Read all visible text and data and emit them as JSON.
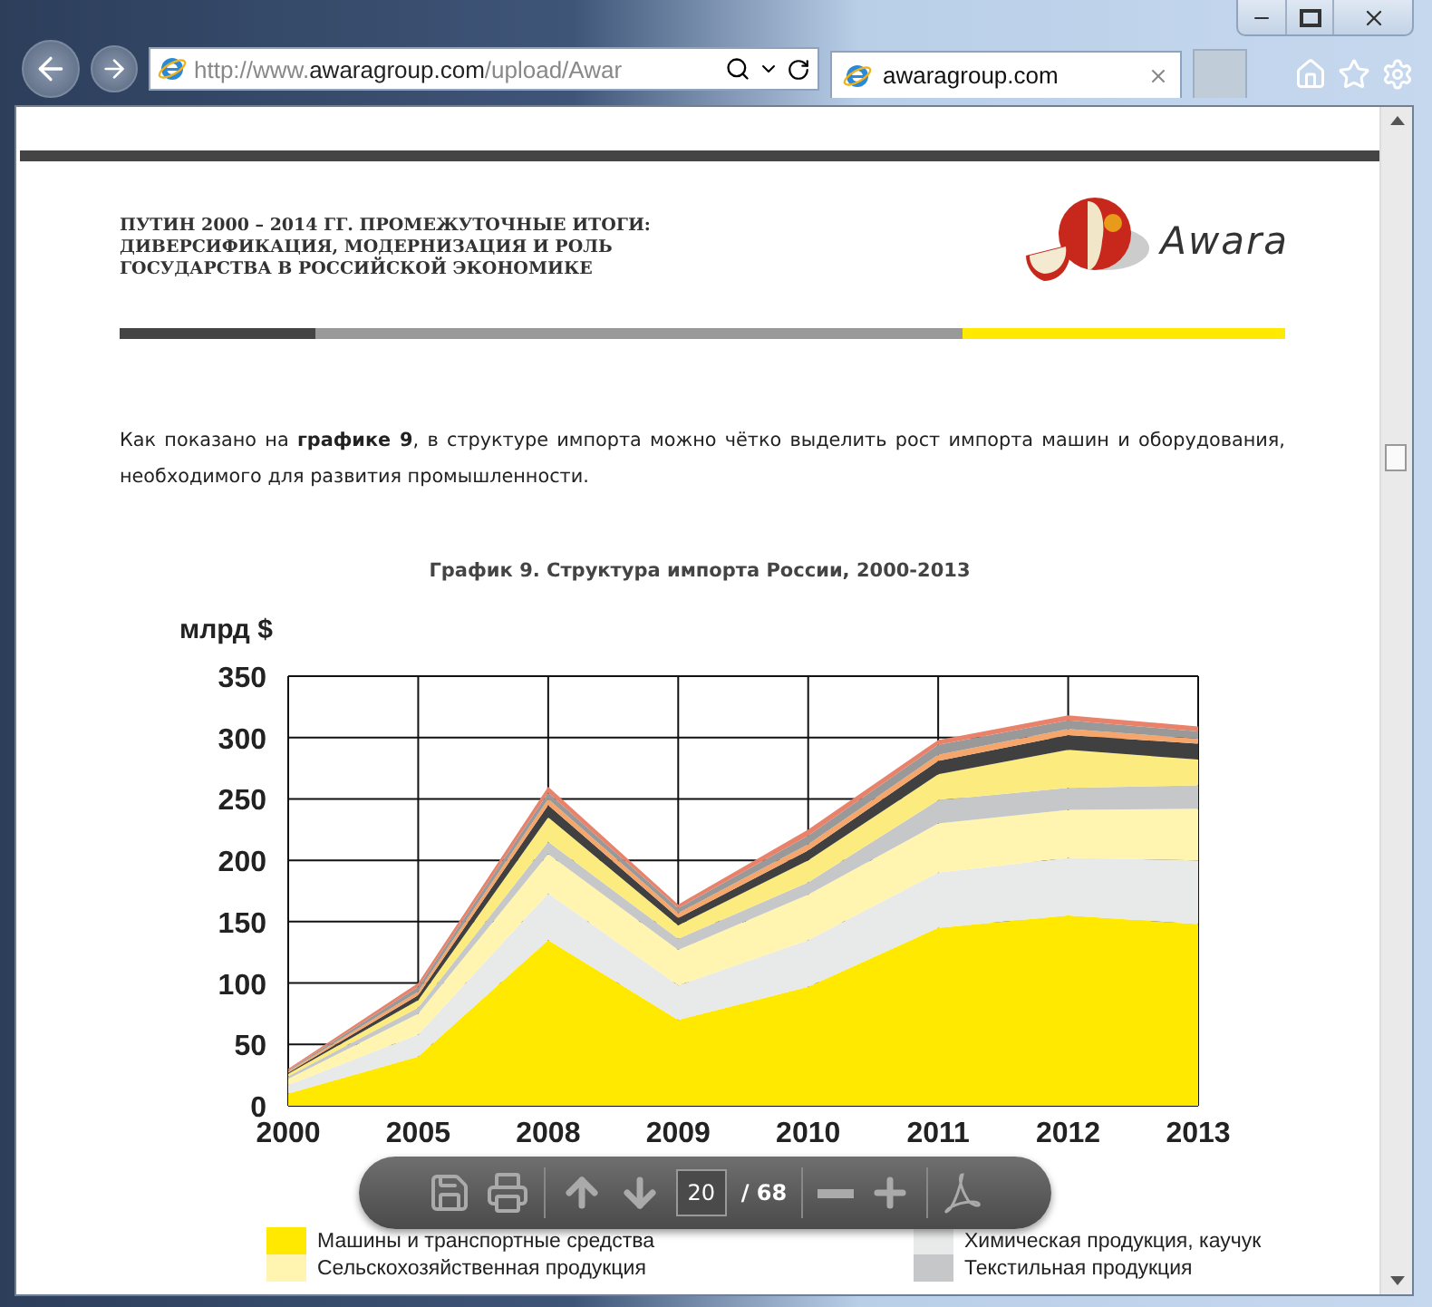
{
  "browser": {
    "address": {
      "prefix": "http://www.",
      "domain": "awaragroup.com",
      "suffix": "/upload/Awar"
    },
    "tabs": [
      {
        "label": "awaragroup.com",
        "selected": true
      }
    ]
  },
  "document": {
    "header_lines": [
      "ПУТИН 2000 – 2014 ГГ. ПРОМЕЖУТОЧНЫЕ ИТОГИ:",
      "ДИВЕРСИФИКАЦИЯ, МОДЕРНИЗАЦИЯ И РОЛЬ",
      "ГОСУДАРСТВА В РОССИЙСКОЙ ЭКОНОМИКЕ"
    ],
    "logo_text": "Awara",
    "paragraph": "Как показано на **графике 9**, в структуре импорта можно чётко выделить рост импорта машин и оборудования, необходимого для развития промышленности.",
    "chart_data": {
      "type": "area",
      "title": "График 9. Структура импорта России, 2000-2013",
      "ylabel": "млрд $",
      "stacked": true,
      "grid": true,
      "categories": [
        "2000",
        "2005",
        "2008",
        "2009",
        "2010",
        "2011",
        "2012",
        "2013"
      ],
      "ylim": [
        0,
        350
      ],
      "yticks": [
        0,
        50,
        100,
        150,
        200,
        250,
        300,
        350
      ],
      "series": [
        {
          "name": "Машины и транспортные средства",
          "color": "#ffe900",
          "values": [
            10,
            40,
            135,
            70,
            97,
            145,
            155,
            148
          ]
        },
        {
          "name": "Химическая продукция, каучук",
          "color": "#e8e9e9",
          "values": [
            7,
            18,
            38,
            28,
            38,
            45,
            47,
            52
          ]
        },
        {
          "name": "Сельскохозяйственная продукция",
          "color": "#fff5b0",
          "values": [
            5,
            17,
            32,
            29,
            37,
            40,
            39,
            42
          ]
        },
        {
          "name": "Текстильная продукция",
          "color": "#c6c7c8",
          "values": [
            2,
            5,
            10,
            9,
            10,
            19,
            18,
            19
          ]
        },
        {
          "color": "#fcec80",
          "values": [
            2,
            6,
            20,
            11,
            18,
            21,
            31,
            21
          ]
        },
        {
          "color": "#404040",
          "values": [
            1,
            4,
            10,
            6,
            8,
            11,
            12,
            13
          ]
        },
        {
          "color": "#f7a66b",
          "values": [
            1,
            3,
            5,
            4,
            5,
            5,
            5,
            4
          ]
        },
        {
          "color": "#999999",
          "values": [
            1,
            4,
            5,
            4,
            7,
            8,
            7,
            6
          ]
        },
        {
          "color": "#e8826a",
          "values": [
            1,
            3,
            5,
            3,
            5,
            4,
            4,
            4
          ]
        }
      ]
    }
  },
  "pdf_toolbar": {
    "page": "20",
    "total": "/ 68"
  }
}
